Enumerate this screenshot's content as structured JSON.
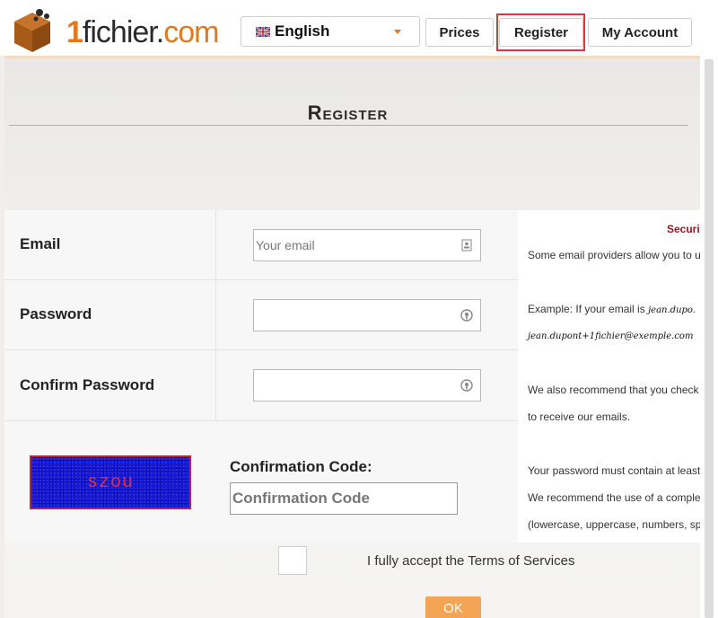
{
  "header": {
    "logo": {
      "one": "1",
      "mid": "fichier.",
      "com": "com"
    },
    "language": {
      "selected": "English",
      "flag_icon": "uk-flag-icon"
    },
    "nav": {
      "prices": "Prices",
      "register": "Register",
      "account": "My Account"
    }
  },
  "page": {
    "title": "Register"
  },
  "form": {
    "email": {
      "label": "Email",
      "placeholder": "Your email",
      "value": ""
    },
    "password": {
      "label": "Password",
      "value": ""
    },
    "confirm_password": {
      "label": "Confirm Password",
      "value": ""
    },
    "captcha": {
      "text": "szou"
    },
    "confirmation_code": {
      "label": "Confirmation Code:",
      "placeholder": "Confirmation Code",
      "value": ""
    },
    "terms": {
      "label": "I fully accept the Terms of Services",
      "checked": false
    },
    "submit": {
      "label": "OK"
    }
  },
  "info": {
    "title": "Securi",
    "lines": [
      "Some email providers allow you to u",
      "Example: If your email is",
      "jean.dupo.",
      "jean.dupont+1fichier@exemple.com",
      "We also recommend that you check",
      "to receive our emails.",
      "Your password must contain at least",
      "We recommend the use of a comple",
      "(lowercase, uppercase, numbers, sp"
    ]
  },
  "colors": {
    "brand_orange": "#e07a1f",
    "highlight_red": "#d9363e",
    "ok_button": "#f3a455",
    "info_title": "#a0141c"
  }
}
